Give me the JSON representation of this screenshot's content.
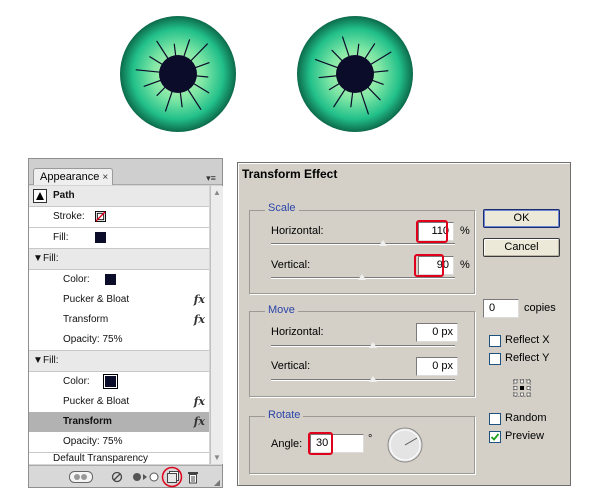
{
  "colors": {
    "iris_inner": "#c5f7a8",
    "iris_mid": "#2fce92",
    "iris_outer": "#0d6d4e",
    "pupil": "#0b0c2a",
    "highlight": "#e0001b",
    "group_title": "#2b45a8"
  },
  "appearance": {
    "tab_label": "Appearance",
    "tab_close": "×",
    "header_label": "Path",
    "rows": [
      {
        "label": "Stroke:",
        "kind": "stroke-swatch"
      },
      {
        "label": "Fill:",
        "kind": "fill-swatch"
      },
      {
        "label": "Fill:",
        "kind": "group"
      },
      {
        "label": "Color:",
        "kind": "fill-swatch"
      },
      {
        "label": "Pucker & Bloat",
        "kind": "fx"
      },
      {
        "label": "Transform",
        "kind": "fx"
      },
      {
        "label": "Opacity: 75%",
        "kind": "text"
      },
      {
        "label": "Fill:",
        "kind": "group"
      },
      {
        "label": "Color:",
        "kind": "fill-swatch"
      },
      {
        "label": "Pucker & Bloat",
        "kind": "fx"
      },
      {
        "label": "Transform",
        "kind": "fx-selected"
      },
      {
        "label": "Opacity: 75%",
        "kind": "text"
      },
      {
        "label": "Default Transparency",
        "kind": "text"
      }
    ],
    "fx_symbol": "fx"
  },
  "dialog": {
    "title": "Transform Effect",
    "scale": {
      "title": "Scale",
      "horizontal_label": "Horizontal:",
      "horizontal_value": "110",
      "horizontal_unit": "%",
      "vertical_label": "Vertical:",
      "vertical_value": "90",
      "vertical_unit": "%"
    },
    "move": {
      "title": "Move",
      "horizontal_label": "Horizontal:",
      "horizontal_value": "0 px",
      "vertical_label": "Vertical:",
      "vertical_value": "0 px"
    },
    "rotate": {
      "title": "Rotate",
      "angle_label": "Angle:",
      "angle_value": "30",
      "angle_unit": "°"
    },
    "copies_value": "0",
    "copies_label": "copies",
    "ok_label": "OK",
    "cancel_label": "Cancel",
    "reflect_x_label": "Reflect X",
    "reflect_y_label": "Reflect Y",
    "random_label": "Random",
    "preview_label": "Preview",
    "reflect_x_checked": false,
    "reflect_y_checked": false,
    "random_checked": false,
    "preview_checked": true
  }
}
